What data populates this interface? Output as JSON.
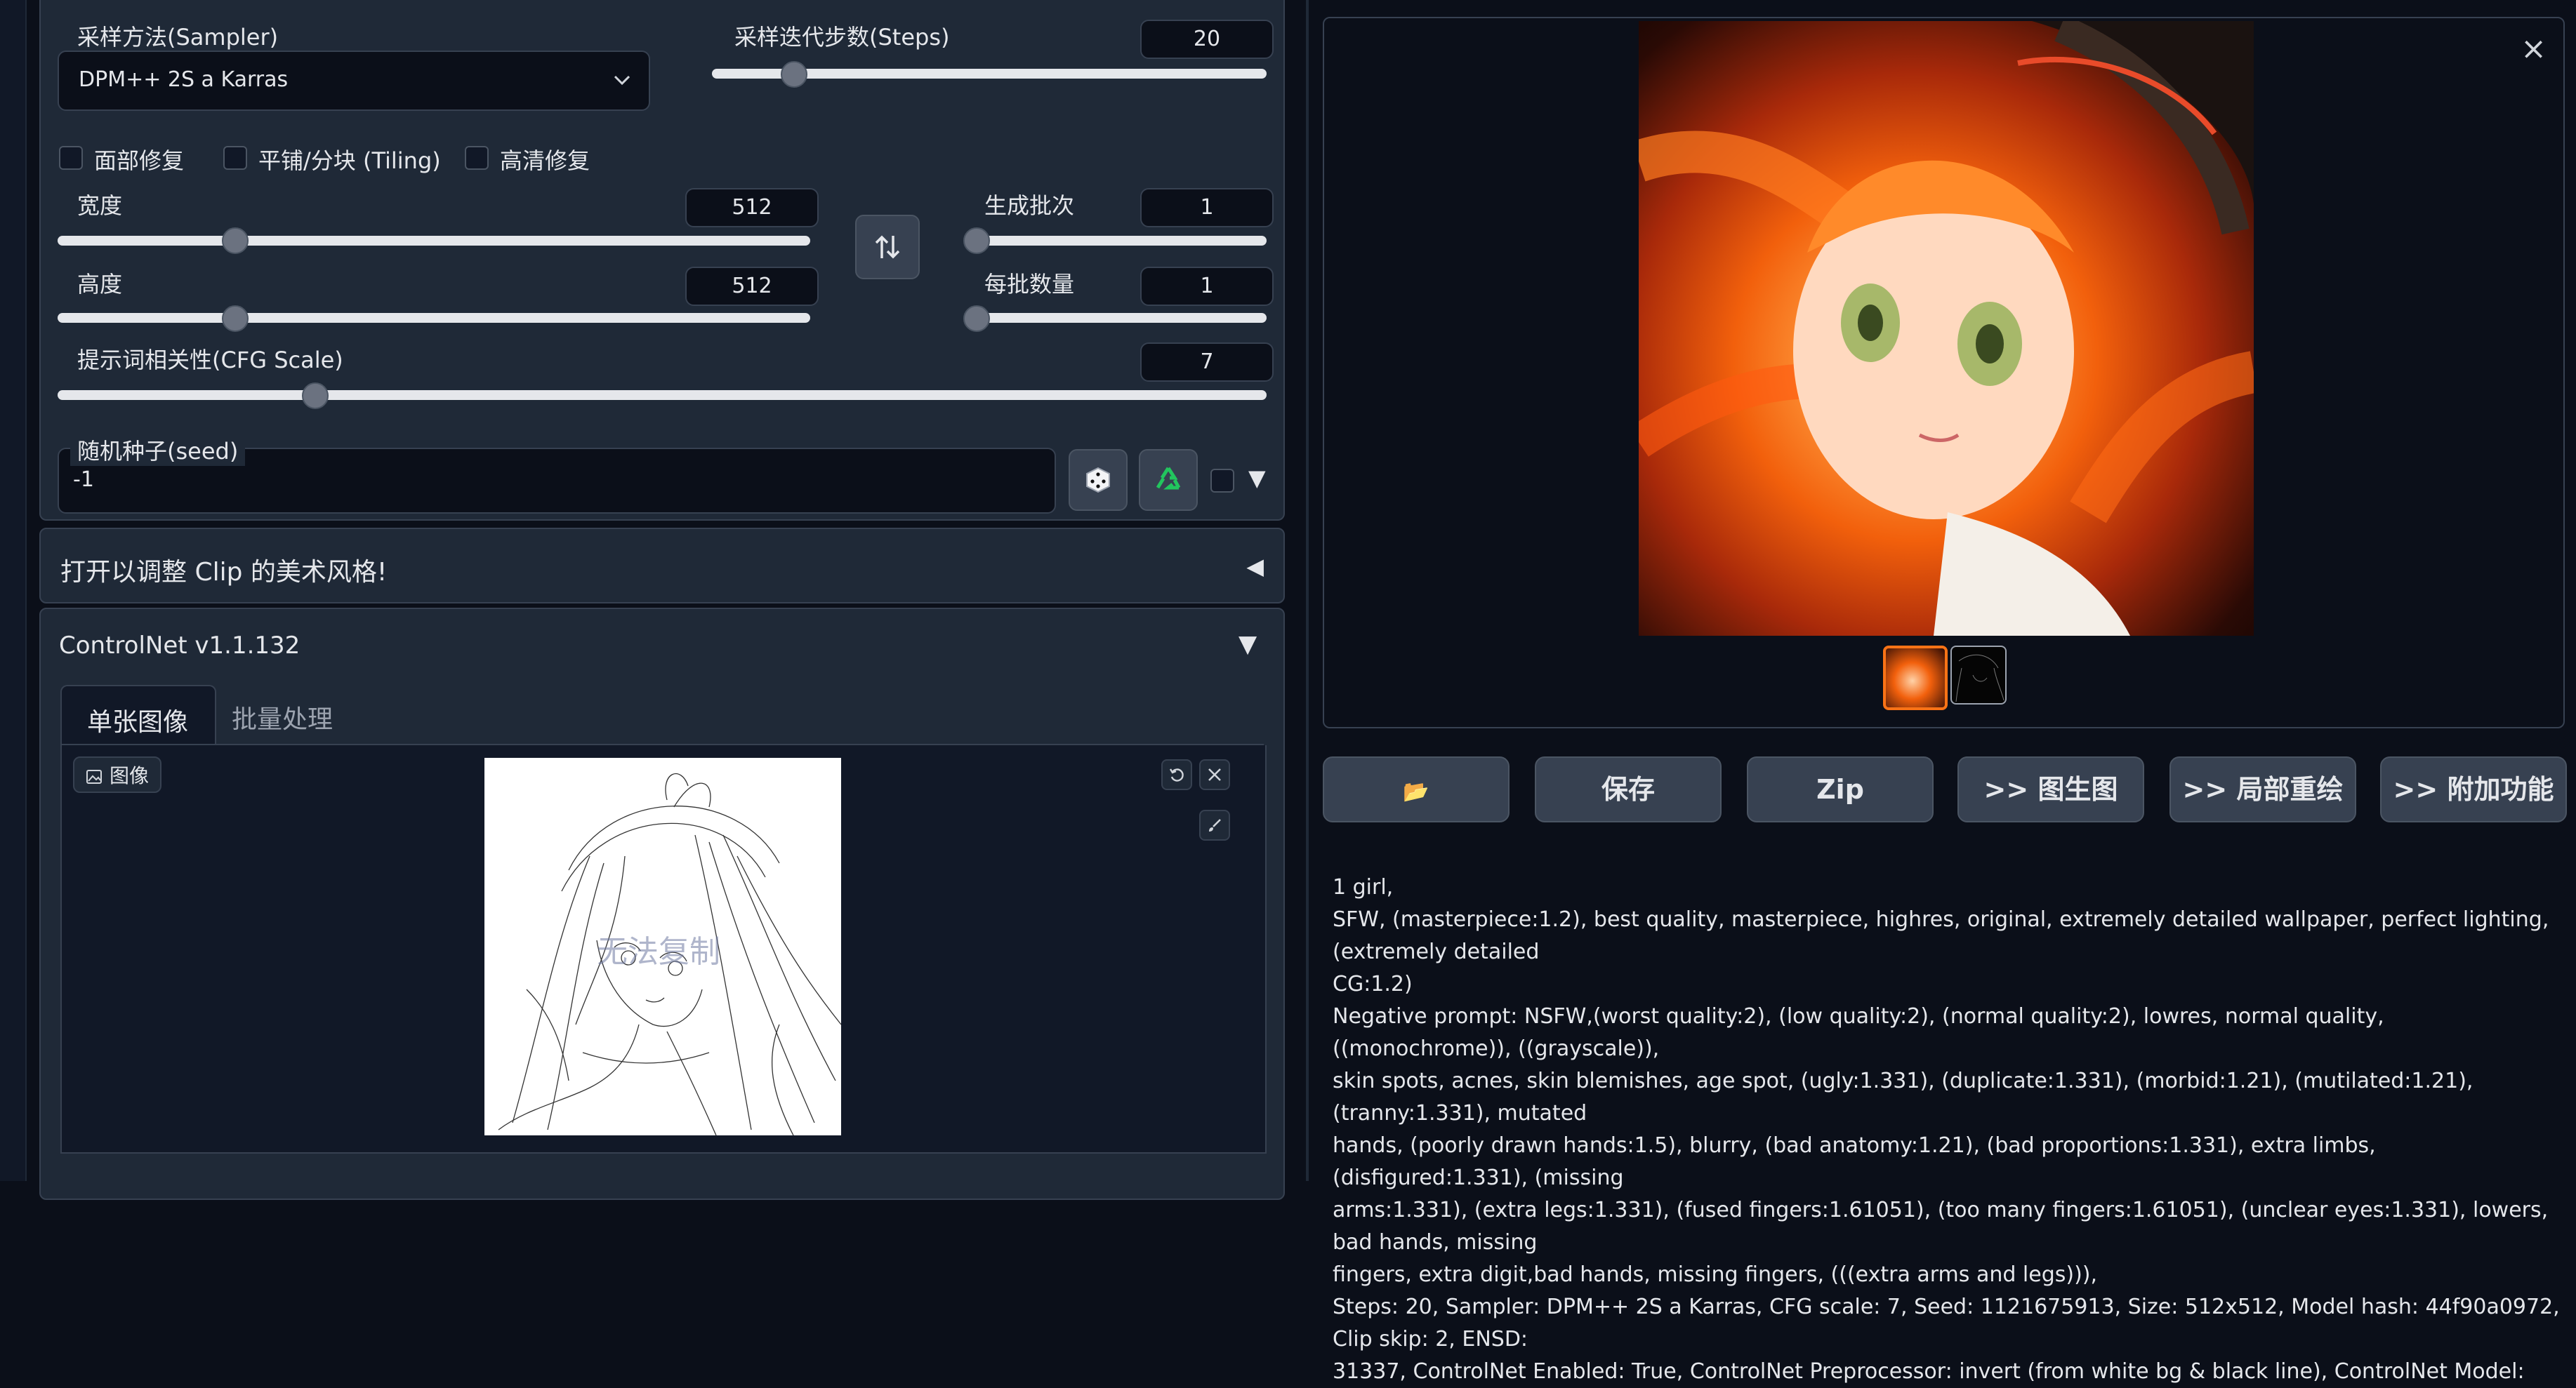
{
  "sampler": {
    "label": "采样方法(Sampler)",
    "value": "DPM++ 2S a Karras"
  },
  "steps": {
    "label": "采样迭代步数(Steps)",
    "value": "20",
    "fraction": 0.13
  },
  "checkboxes": {
    "face_restore": "面部修复",
    "tiling": "平铺/分块 (Tiling)",
    "hires_fix": "高清修复"
  },
  "width": {
    "label": "宽度",
    "value": "512",
    "fraction": 0.2
  },
  "height": {
    "label": "高度",
    "value": "512",
    "fraction": 0.2
  },
  "batch_count": {
    "label": "生成批次",
    "value": "1",
    "fraction": 0.0
  },
  "batch_size": {
    "label": "每批数量",
    "value": "1",
    "fraction": 0.0
  },
  "cfg": {
    "label": "提示词相关性(CFG Scale)",
    "value": "7",
    "fraction": 0.2
  },
  "seed": {
    "label": "随机种子(seed)",
    "value": "-1"
  },
  "clip_style": {
    "label": "打开以调整 Clip 的美术风格!",
    "arrow": "◀"
  },
  "controlnet": {
    "title": "ControlNet v1.1.132",
    "arrow": "▼",
    "tabs": [
      "单张图像",
      "批量处理"
    ],
    "image_label": "图像",
    "watermark": "无法复制"
  },
  "seed_extra_arrow": "▼",
  "gallery": {
    "close_glyph": "×"
  },
  "buttons": {
    "folder": "📂",
    "save": "保存",
    "zip": "Zip",
    "img2img": ">> 图生图",
    "inpaint": ">> 局部重绘",
    "extras": ">> 附加功能"
  },
  "output_text": [
    "1 girl,",
    "SFW, (masterpiece:1.2), best quality, masterpiece, highres, original, extremely detailed wallpaper, perfect lighting,(extremely detailed",
    "CG:1.2)",
    "Negative prompt: NSFW,(worst quality:2), (low quality:2), (normal quality:2), lowres, normal quality, ((monochrome)), ((grayscale)),",
    "skin spots, acnes, skin blemishes, age spot, (ugly:1.331), (duplicate:1.331), (morbid:1.21), (mutilated:1.21), (tranny:1.331), mutated",
    "hands, (poorly drawn hands:1.5), blurry, (bad anatomy:1.21), (bad proportions:1.331), extra limbs, (disfigured:1.331), (missing",
    "arms:1.331), (extra legs:1.331), (fused fingers:1.61051), (too many fingers:1.61051), (unclear eyes:1.331), lowers, bad hands, missing",
    "fingers, extra digit,bad hands, missing fingers, (((extra arms and legs))),",
    "Steps: 20, Sampler: DPM++ 2S a Karras, CFG scale: 7, Seed: 1121675913, Size: 512x512, Model hash: 44f90a0972, Clip skip: 2, ENSD:",
    "31337, ControlNet Enabled: True, ControlNet Preprocessor: invert (from white bg & black line), ControlNet Model:"
  ]
}
